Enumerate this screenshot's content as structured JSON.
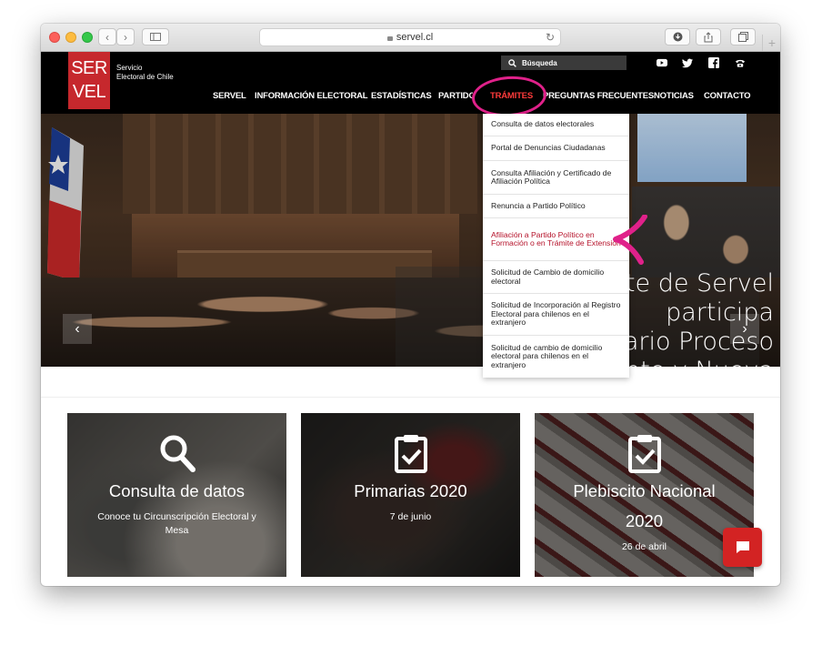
{
  "browser": {
    "url": "servel.cl"
  },
  "site": {
    "logo_text_line1": "SER",
    "logo_text_line2": "VEL",
    "logo_sub_line1": "Servicio",
    "logo_sub_line2": "Electoral de Chile",
    "search_placeholder": "Búsqueda",
    "social": [
      "youtube-icon",
      "twitter-icon",
      "facebook-icon",
      "phone-icon"
    ]
  },
  "nav": {
    "items": [
      "SERVEL",
      "INFORMACIÓN ELECTORAL",
      "ESTADÍSTICAS",
      "PARTIDOS",
      "TRÁMITES",
      "PREGUNTAS FRECUENTES",
      "NOTICIAS",
      "CONTACTO"
    ],
    "active": "TRÁMITES",
    "active_color": "#ff3b3b"
  },
  "dropdown": {
    "items": [
      "Consulta de datos electorales",
      "Portal de Denuncias Ciudadanas",
      "Consulta Afiliación y Certificado de Afiliación Política",
      "Renuncia a Partido Político",
      "Afiliación a Partido Político en Formación o en Trámite de Extensión",
      "Solicitud de Cambio de domicilio electoral",
      "Solicitud de Incorporación al Registro Electoral para chilenos en el extranjero",
      "Solicitud de cambio de domicilio electoral para chilenos en el extranjero"
    ],
    "highlighted_index": 4,
    "highlight_color": "#b5122a"
  },
  "hero": {
    "caption": "Presidente de Servel participa\nen Itinerario Proceso\nConstituyente y Nueva\nConstitución"
  },
  "cards": [
    {
      "title": "Consulta de datos",
      "subtitle": "Conoce tu Circunscripción Electoral y Mesa",
      "icon": "search-icon"
    },
    {
      "title": "Primarias 2020",
      "subtitle": "7 de junio",
      "icon": "clipboard-check-icon"
    },
    {
      "title": "Plebiscito Nacional 2020",
      "subtitle": "26 de abril",
      "icon": "clipboard-check-icon"
    }
  ],
  "colors": {
    "brand_red": "#c6282d",
    "annotation_pink": "#e0218a",
    "chat_red": "#d32323"
  }
}
